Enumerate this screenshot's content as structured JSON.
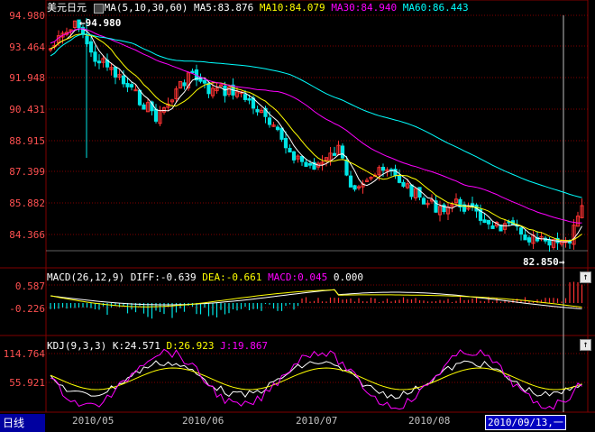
{
  "instrument": {
    "name": "美元日元",
    "ma_indicator_label": "MA(5,10,30,60)",
    "ma5": "MA5:83.876",
    "ma10": "MA10:84.079",
    "ma30": "MA30:84.940",
    "ma60": "MA60:86.443"
  },
  "price_axis": [
    "94.980",
    "93.464",
    "91.948",
    "90.431",
    "88.915",
    "87.399",
    "85.882",
    "84.366"
  ],
  "markers": {
    "high": "94.980",
    "low": "82.850"
  },
  "macd": {
    "label": "MACD(26,12,9)",
    "diff": "DIFF:-0.639",
    "dea": "DEA:-0.661",
    "macd": "MACD:0.045",
    "extra": "0.000",
    "axis": [
      "0.587",
      "-0.226"
    ]
  },
  "kdj": {
    "label": "KDJ(9,3,3)",
    "k": "K:24.571",
    "d": "D:26.923",
    "j": "J:19.867",
    "axis": [
      "114.764",
      "55.921"
    ]
  },
  "period_tab": "日线",
  "date_axis": [
    "2010/05",
    "2010/06",
    "2010/07",
    "2010/08"
  ],
  "cursor_date": "2010/09/13,一",
  "colors": {
    "up": "#ff3232",
    "down": "#00e5e5",
    "ma5": "#ffffff",
    "ma10": "#ffff00",
    "ma30": "#ff00ff",
    "ma60": "#00ffff",
    "grid": "#800000"
  }
}
